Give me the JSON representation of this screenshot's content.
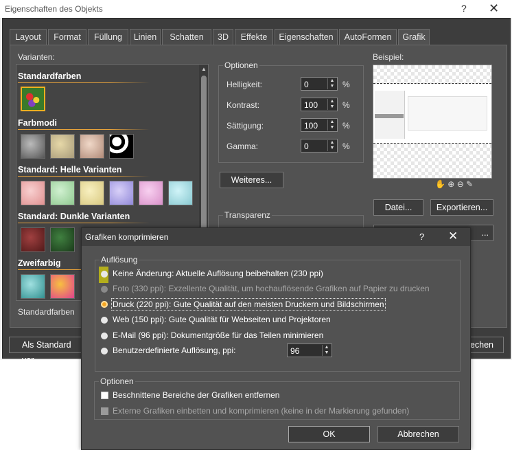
{
  "window": {
    "title": "Eigenschaften des Objekts",
    "help": "?",
    "close": "✕",
    "tabs": [
      "Layout",
      "Format",
      "Füllung",
      "Linien",
      "Schatten",
      "3D",
      "Effekte",
      "Eigenschaften",
      "AutoFormen",
      "Grafik"
    ],
    "active_tab": "Grafik",
    "variants": {
      "label": "Varianten:",
      "sections": [
        "Standardfarben",
        "Farbmodi",
        "Standard: Helle Varianten",
        "Standard: Dunkle Varianten",
        "Zweifarbig"
      ],
      "selected_name": "Standardfarben"
    },
    "options": {
      "title": "Optionen",
      "rows": [
        {
          "label": "Helligkeit:",
          "value": "0",
          "unit": "%"
        },
        {
          "label": "Kontrast:",
          "value": "100",
          "unit": "%"
        },
        {
          "label": "Sättigung:",
          "value": "100",
          "unit": "%"
        },
        {
          "label": "Gamma:",
          "value": "0",
          "unit": "%"
        }
      ],
      "more_button": "Weiteres..."
    },
    "transparency_title": "Transparenz",
    "preview": {
      "label": "Beispiel:",
      "file_button": "Datei...",
      "export_button": "Exportieren...",
      "third_button_fragment": "..."
    },
    "bottom": {
      "default_button_fragment": "Als Standard ver",
      "cancel_fragment": "rechen"
    }
  },
  "dialog": {
    "title": "Grafiken komprimieren",
    "help": "?",
    "close": "✕",
    "resolution": {
      "title": "Auflösung",
      "options": [
        "Keine Änderung: Aktuelle Auflösung beibehalten (230 ppi)",
        "Foto (330 ppi): Exzellente Qualität, um hochauflösende Grafiken auf Papier zu drucken",
        "Druck (220 ppi): Gute Qualität auf den meisten Druckern und Bildschirmen",
        "Web (150 ppi): Gute Qualität für Webseiten und Projektoren",
        "E-Mail (96 ppi): Dokumentgröße für das Teilen minimieren",
        "Benutzerdefinierte Auflösung, ppi:"
      ],
      "selected_index": 2,
      "custom_ppi": "96"
    },
    "options": {
      "title": "Optionen",
      "items": [
        "Beschnittene Bereiche der Grafiken entfernen",
        "Externe Grafiken einbetten und komprimieren (keine in der Markierung gefunden)"
      ]
    },
    "ok_button": "OK",
    "cancel_button": "Abbrechen"
  },
  "colors": {
    "dialog_bg": "#525252",
    "accent_orange": "#f5a623",
    "highlight_marker": "#e8e000",
    "selection_border": "#f0b020"
  }
}
